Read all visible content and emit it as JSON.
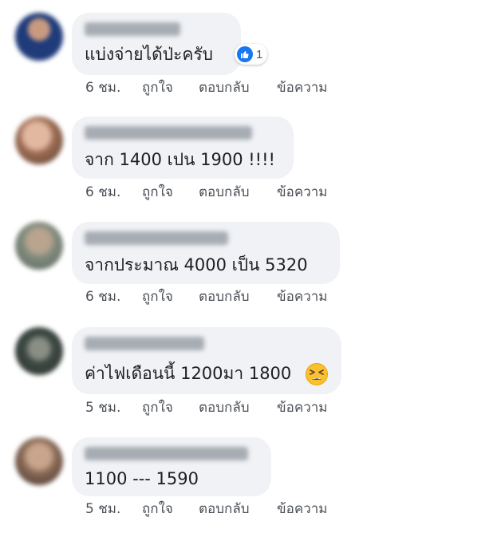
{
  "actions": {
    "like": "ถูกใจ",
    "reply": "ตอบกลับ",
    "message": "ข้อความ"
  },
  "colors": {
    "bubble": "#f0f2f5",
    "like_blue": "#1877f2",
    "emoji_yellow": "#fbc02d"
  },
  "comments": [
    {
      "text": "แบ่งจ่ายได้ป่ะครับ",
      "time": "6 ชม.",
      "reaction": {
        "icon": "thumbs-up-icon",
        "count": "1"
      }
    },
    {
      "text": "จาก 1400 เปน 1900 !!!!",
      "time": "6 ชม."
    },
    {
      "text": "จากประมาณ 4000 เป็น 5320",
      "time": "6 ชม."
    },
    {
      "text": "ค่าไฟเดือนนี้ 1200มา 1800",
      "time": "5 ชม.",
      "emoji": "tired-face-icon"
    },
    {
      "text": "1100 --- 1590",
      "time": "5 ชม."
    }
  ]
}
